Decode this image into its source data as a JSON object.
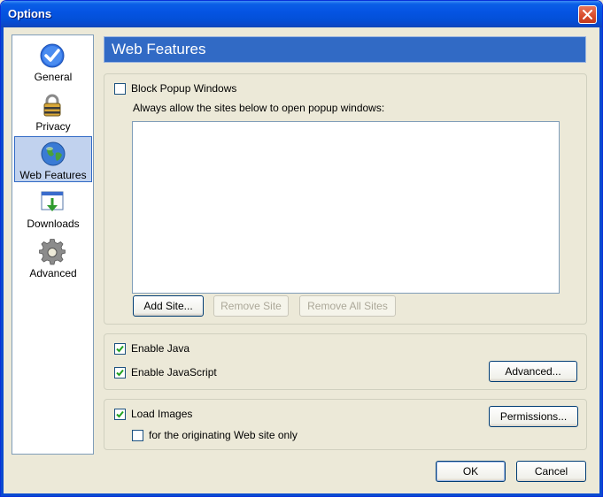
{
  "window": {
    "title": "Options"
  },
  "sidebar": {
    "items": [
      {
        "label": "General",
        "icon": "checkmark-icon"
      },
      {
        "label": "Privacy",
        "icon": "padlock-icon"
      },
      {
        "label": "Web Features",
        "icon": "globe-icon",
        "selected": true
      },
      {
        "label": "Downloads",
        "icon": "download-icon"
      },
      {
        "label": "Advanced",
        "icon": "gear-icon"
      }
    ]
  },
  "page": {
    "heading": "Web Features"
  },
  "popups": {
    "block_label": "Block Popup Windows",
    "block_checked": false,
    "allow_description": "Always allow the sites below to open popup windows:",
    "allowed_sites": [],
    "add_site": "Add Site...",
    "remove_site": "Remove Site",
    "remove_all_sites": "Remove All Sites"
  },
  "java": {
    "enable_java_label": "Enable Java",
    "enable_java_checked": true,
    "enable_javascript_label": "Enable JavaScript",
    "enable_javascript_checked": true,
    "advanced_button": "Advanced..."
  },
  "images": {
    "load_images_label": "Load Images",
    "load_images_checked": true,
    "originating_only_label": "for the originating Web site only",
    "originating_only_checked": false,
    "permissions_button": "Permissions..."
  },
  "dialog_buttons": {
    "ok": "OK",
    "cancel": "Cancel"
  },
  "colors": {
    "titlebar": "#0554e3",
    "selection": "#c1d2ee",
    "heading_bg": "#316ac5",
    "face": "#ece9d8"
  }
}
